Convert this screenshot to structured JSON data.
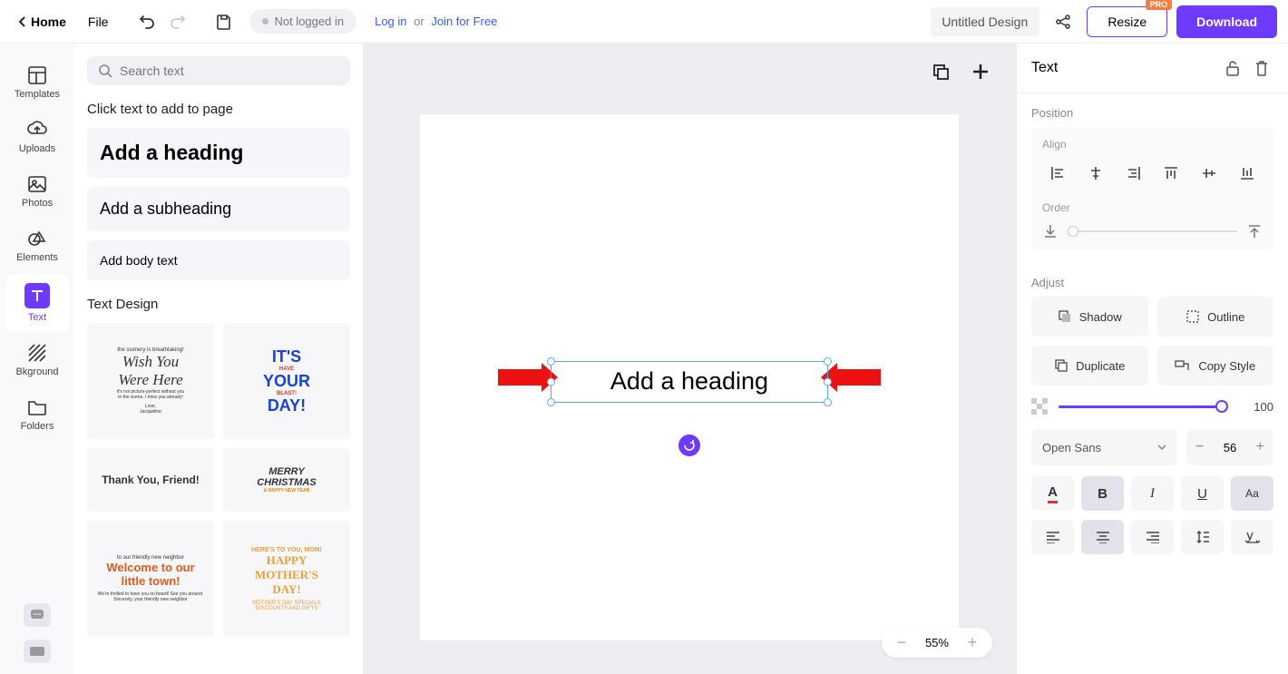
{
  "topbar": {
    "home": "Home",
    "file": "File",
    "status": "Not logged in",
    "login": "Log in",
    "or": "or",
    "join": "Join for Free",
    "title": "Untitled Design",
    "resize": "Resize",
    "pro": "PRO",
    "download": "Download"
  },
  "rail": {
    "templates": "Templates",
    "uploads": "Uploads",
    "photos": "Photos",
    "elements": "Elements",
    "text": "Text",
    "bkground": "Bkground",
    "folders": "Folders"
  },
  "panel": {
    "search_placeholder": "Search text",
    "click_heading": "Click text to add to page",
    "add_heading": "Add a heading",
    "add_subheading": "Add a subheading",
    "add_body": "Add body text",
    "text_design": "Text Design",
    "designs": {
      "d1_l1": "the scenery is breathtaking!",
      "d1_l2": "Wish You",
      "d1_l3": "Were Here",
      "d1_l4": "it's not picture-perfect without you",
      "d1_l5": "in the scene. I miss you already!",
      "d1_l6": "Love,",
      "d1_l7": "Jacqueline",
      "d2_l1": "IT'S",
      "d2_l2": "HAVE",
      "d2_l3": "YOUR",
      "d2_l4": "BLAST!",
      "d2_l5": "DAY!",
      "d3": "Thank You, Friend!",
      "d4_l1": "MERRY",
      "d4_l2": "CHRISTMAS",
      "d4_l3": "& HAPPY NEW YEAR",
      "d5_l1": "to our friendly new neighbor",
      "d5_l2": "Welcome to our",
      "d5_l3": "little town!",
      "d5_l4": "We're thrilled to have you on board! See you around.",
      "d5_l5": "Sincerely, your friendly new neighbor",
      "d6_l1": "HERE'S TO YOU, MOM!",
      "d6_l2": "HAPPY",
      "d6_l3": "MOTHER'S",
      "d6_l4": "DAY!",
      "d6_l5": "MOTHER'S DAY SPECIALS",
      "d6_l6": "DISCOUNTS AND GIFTS"
    }
  },
  "canvas": {
    "text_content": "Add a heading",
    "zoom": "55%"
  },
  "inspector": {
    "title": "Text",
    "position": "Position",
    "align": "Align",
    "order": "Order",
    "adjust": "Adjust",
    "shadow": "Shadow",
    "outline": "Outline",
    "duplicate": "Duplicate",
    "copy_style": "Copy Style",
    "opacity": "100",
    "font": "Open Sans",
    "font_size": "56"
  }
}
